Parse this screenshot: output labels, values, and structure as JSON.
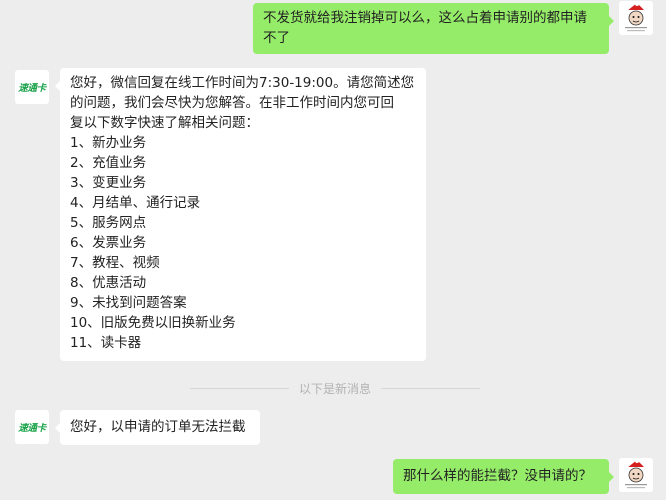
{
  "contacts": {
    "service": {
      "avatar_text": "速通卡"
    }
  },
  "messages": {
    "m1": {
      "lines": [
        "不发货就给我注销掉可以么，这么占着申请别的都申请",
        "不了"
      ]
    },
    "m2": {
      "lines": [
        "您好，微信回复在线工作时间为7:30-19:00。请您简述您",
        "的问题，我们会尽快为您解答。在非工作时间内您可回",
        "复以下数字快速了解相关问题：",
        "1、新办业务",
        "2、充值业务",
        "3、变更业务",
        "4、月结单、通行记录",
        "5、服务网点",
        "6、发票业务",
        "7、教程、视频",
        "8、优惠活动",
        "9、未找到问题答案",
        "10、旧版免费以旧换新业务",
        "11、读卡器"
      ]
    },
    "m3": {
      "lines": [
        "您好，以申请的订单无法拦截"
      ]
    },
    "m4": {
      "lines": [
        "那什么样的能拦截？没申请的？"
      ]
    }
  },
  "divider": {
    "label": "以下是新消息"
  },
  "colors": {
    "outgoing_bubble": "#95ec69",
    "incoming_bubble": "#ffffff",
    "background": "#ededed",
    "brand_green": "#1aa34a"
  }
}
